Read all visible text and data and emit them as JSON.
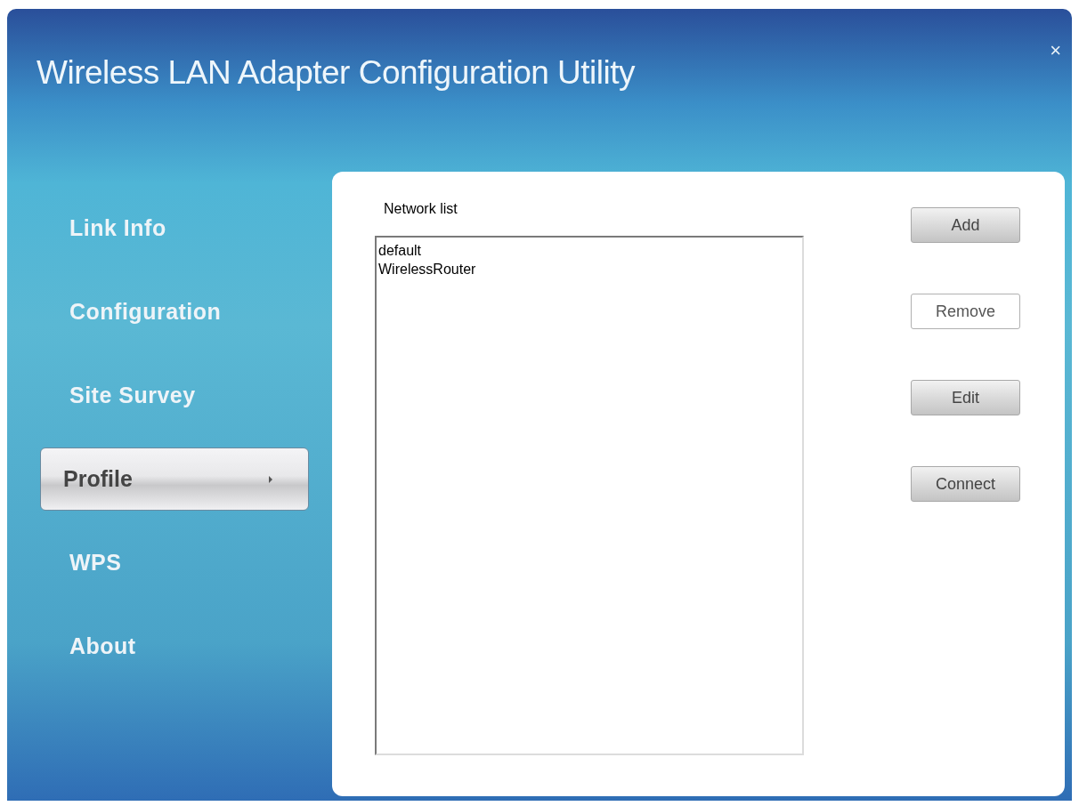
{
  "window": {
    "title": "Wireless LAN Adapter Configuration Utility",
    "close": "×"
  },
  "sidebar": {
    "items": [
      {
        "label": "Link Info",
        "selected": false
      },
      {
        "label": "Configuration",
        "selected": false
      },
      {
        "label": "Site Survey",
        "selected": false
      },
      {
        "label": "Profile",
        "selected": true
      },
      {
        "label": "WPS",
        "selected": false
      },
      {
        "label": "About",
        "selected": false
      }
    ]
  },
  "network_list": {
    "label": "Network list",
    "items": [
      "default",
      "WirelessRouter"
    ]
  },
  "buttons": [
    {
      "label": "Add",
      "highlighted": false
    },
    {
      "label": "Remove",
      "highlighted": true
    },
    {
      "label": "Edit",
      "highlighted": false
    },
    {
      "label": "Connect",
      "highlighted": false
    }
  ]
}
